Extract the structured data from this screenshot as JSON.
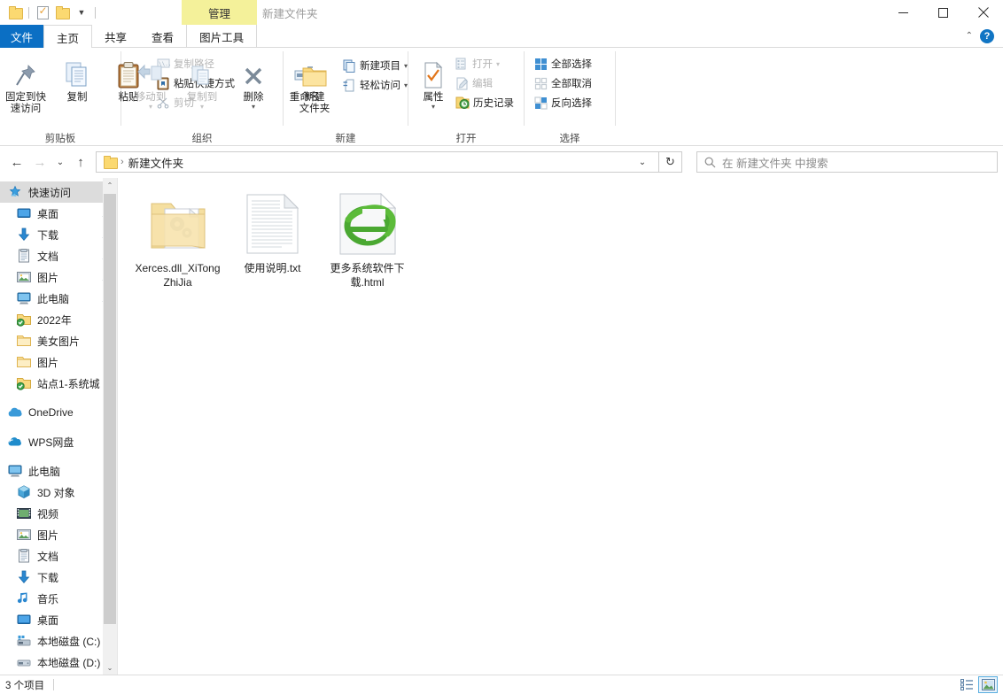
{
  "window": {
    "title": "新建文件夹",
    "contextual_tab_group": "管理",
    "minimize": "—",
    "maximize": "□",
    "close": "✕",
    "help": "?",
    "collapse_ribbon": "⌃"
  },
  "quick_access_toolbar": {
    "items": [
      {
        "name": "folder-icon",
        "label": ""
      },
      {
        "name": "properties-icon",
        "label": ""
      },
      {
        "name": "new-folder-icon",
        "label": ""
      },
      {
        "name": "customize-dropdown",
        "label": "▼"
      }
    ]
  },
  "tabs": [
    {
      "id": "file",
      "label": "文件",
      "state": "file"
    },
    {
      "id": "home",
      "label": "主页",
      "state": "active"
    },
    {
      "id": "share",
      "label": "共享",
      "state": "normal"
    },
    {
      "id": "view",
      "label": "查看",
      "state": "normal"
    },
    {
      "id": "picture-tools",
      "label": "图片工具",
      "state": "contextual"
    }
  ],
  "ribbon": {
    "groups": [
      {
        "id": "clipboard",
        "label": "剪贴板",
        "large_buttons": [
          {
            "id": "pin-to-quick-access",
            "label": "固定到快\n速访问",
            "line1": "固定到快",
            "line2": "速访问",
            "icon": "pin-icon",
            "dim": false
          },
          {
            "id": "copy",
            "label": "复制",
            "line1": "复制",
            "line2": "",
            "icon": "copy-icon",
            "dim": false
          },
          {
            "id": "paste",
            "label": "粘贴",
            "line1": "粘贴",
            "line2": "",
            "icon": "paste-icon",
            "dim": false
          }
        ],
        "small_buttons": [
          {
            "id": "copy-path",
            "label": "复制路径",
            "icon": "copy-path-icon",
            "dim": true
          },
          {
            "id": "paste-shortcut",
            "label": "粘贴快捷方式",
            "icon": "paste-shortcut-icon",
            "dim": false
          },
          {
            "id": "cut",
            "label": "剪切",
            "icon": "scissors-icon",
            "dim": true
          }
        ]
      },
      {
        "id": "organize",
        "label": "组织",
        "large_buttons": [
          {
            "id": "move-to",
            "label": "移动到",
            "line1": "移动到",
            "line2": "",
            "icon": "move-to-icon",
            "dim": true,
            "caret": true
          },
          {
            "id": "copy-to",
            "label": "复制到",
            "line1": "复制到",
            "line2": "",
            "icon": "copy-to-icon",
            "dim": true,
            "caret": true
          },
          {
            "id": "delete",
            "label": "删除",
            "line1": "删除",
            "line2": "",
            "icon": "delete-icon",
            "dim": false,
            "caret": true
          },
          {
            "id": "rename",
            "label": "重命名",
            "line1": "重命名",
            "line2": "",
            "icon": "rename-icon",
            "dim": false
          }
        ]
      },
      {
        "id": "new",
        "label": "新建",
        "large_buttons": [
          {
            "id": "new-folder",
            "label": "新建\n文件夹",
            "line1": "新建",
            "line2": "文件夹",
            "icon": "new-folder-icon",
            "dim": false
          }
        ],
        "small_buttons": [
          {
            "id": "new-item",
            "label": "新建项目",
            "icon": "new-item-icon",
            "dim": false,
            "dropdown": "▾"
          },
          {
            "id": "easy-access",
            "label": "轻松访问",
            "icon": "easy-access-icon",
            "dim": false,
            "dropdown": "▾"
          }
        ]
      },
      {
        "id": "open",
        "label": "打开",
        "large_buttons": [
          {
            "id": "properties",
            "label": "属性",
            "line1": "属性",
            "line2": "",
            "icon": "properties-icon",
            "dim": false,
            "caret": true
          }
        ],
        "small_buttons": [
          {
            "id": "open",
            "label": "打开",
            "icon": "open-icon",
            "dim": true,
            "dropdown": "▾"
          },
          {
            "id": "edit",
            "label": "编辑",
            "icon": "edit-icon",
            "dim": true
          },
          {
            "id": "history",
            "label": "历史记录",
            "icon": "history-icon",
            "dim": false
          }
        ]
      },
      {
        "id": "select",
        "label": "选择",
        "small_buttons": [
          {
            "id": "select-all",
            "label": "全部选择",
            "icon": "select-all-icon",
            "dim": false
          },
          {
            "id": "select-none",
            "label": "全部取消",
            "icon": "select-none-icon",
            "dim": false
          },
          {
            "id": "invert-selection",
            "label": "反向选择",
            "icon": "invert-selection-icon",
            "dim": false
          }
        ]
      }
    ]
  },
  "addressbar": {
    "back": "←",
    "forward": "→",
    "recent": "⌄",
    "up": "↑",
    "path_separator": "›",
    "path_text": "新建文件夹",
    "path_dropdown": "⌄",
    "refresh": "↻",
    "search_placeholder": "在 新建文件夹 中搜索"
  },
  "sidebar": {
    "items": [
      {
        "label": "快速访问",
        "icon": "quick-access-star-icon",
        "level": 0,
        "selected": true,
        "pinned": false,
        "group_start": false
      },
      {
        "label": "桌面",
        "icon": "desktop-icon",
        "level": 1,
        "selected": false,
        "pinned": true,
        "group_start": false
      },
      {
        "label": "下载",
        "icon": "downloads-icon",
        "level": 1,
        "selected": false,
        "pinned": true,
        "group_start": false
      },
      {
        "label": "文档",
        "icon": "documents-icon",
        "level": 1,
        "selected": false,
        "pinned": true,
        "group_start": false
      },
      {
        "label": "图片",
        "icon": "pictures-icon",
        "level": 1,
        "selected": false,
        "pinned": true,
        "group_start": false
      },
      {
        "label": "此电脑",
        "icon": "this-pc-icon",
        "level": 1,
        "selected": false,
        "pinned": true,
        "group_start": false
      },
      {
        "label": "2022年",
        "icon": "synced-folder-icon",
        "level": 1,
        "selected": false,
        "pinned": false,
        "group_start": false
      },
      {
        "label": "美女图片",
        "icon": "folder-icon",
        "level": 1,
        "selected": false,
        "pinned": false,
        "group_start": false
      },
      {
        "label": "图片",
        "icon": "folder-icon",
        "level": 1,
        "selected": false,
        "pinned": false,
        "group_start": false
      },
      {
        "label": "站点1-系统城",
        "icon": "synced-folder-icon",
        "level": 1,
        "selected": false,
        "pinned": false,
        "group_start": false
      },
      {
        "label": "OneDrive",
        "icon": "onedrive-icon",
        "level": 0,
        "selected": false,
        "pinned": false,
        "group_start": true
      },
      {
        "label": "WPS网盘",
        "icon": "wps-cloud-icon",
        "level": 0,
        "selected": false,
        "pinned": false,
        "group_start": true
      },
      {
        "label": "此电脑",
        "icon": "this-pc-icon",
        "level": 0,
        "selected": false,
        "pinned": false,
        "group_start": true
      },
      {
        "label": "3D 对象",
        "icon": "3d-objects-icon",
        "level": 1,
        "selected": false,
        "pinned": false,
        "group_start": false
      },
      {
        "label": "视频",
        "icon": "videos-icon",
        "level": 1,
        "selected": false,
        "pinned": false,
        "group_start": false
      },
      {
        "label": "图片",
        "icon": "pictures-icon",
        "level": 1,
        "selected": false,
        "pinned": false,
        "group_start": false
      },
      {
        "label": "文档",
        "icon": "documents-icon",
        "level": 1,
        "selected": false,
        "pinned": false,
        "group_start": false
      },
      {
        "label": "下载",
        "icon": "downloads-icon",
        "level": 1,
        "selected": false,
        "pinned": false,
        "group_start": false
      },
      {
        "label": "音乐",
        "icon": "music-icon",
        "level": 1,
        "selected": false,
        "pinned": false,
        "group_start": false
      },
      {
        "label": "桌面",
        "icon": "desktop-icon",
        "level": 1,
        "selected": false,
        "pinned": false,
        "group_start": false
      },
      {
        "label": "本地磁盘 (C:)",
        "icon": "system-drive-icon",
        "level": 1,
        "selected": false,
        "pinned": false,
        "group_start": false
      },
      {
        "label": "本地磁盘 (D:)",
        "icon": "drive-icon",
        "level": 1,
        "selected": false,
        "pinned": false,
        "group_start": false
      }
    ],
    "scroll_up": "⌃",
    "scroll_down": "⌄"
  },
  "files": [
    {
      "name": "Xerces.dll_XiTongZhiJia",
      "icon": "folder-with-gears-icon",
      "type": "folder"
    },
    {
      "name": "使用说明.txt",
      "icon": "text-file-icon",
      "type": "txt"
    },
    {
      "name": "更多系统软件下载.html",
      "icon": "internet-explorer-html-icon",
      "type": "html"
    }
  ],
  "statusbar": {
    "item_count": "3 个项目",
    "view_details": "details-view",
    "view_large_icons": "large-icons-view"
  },
  "colors": {
    "file_tab_blue": "#0b6fc4",
    "contextual_yellow": "#f4f19a",
    "selection_gray": "#dcdcdc",
    "accent_blue": "#1175c4",
    "folder_yellow": "#fbd971"
  }
}
